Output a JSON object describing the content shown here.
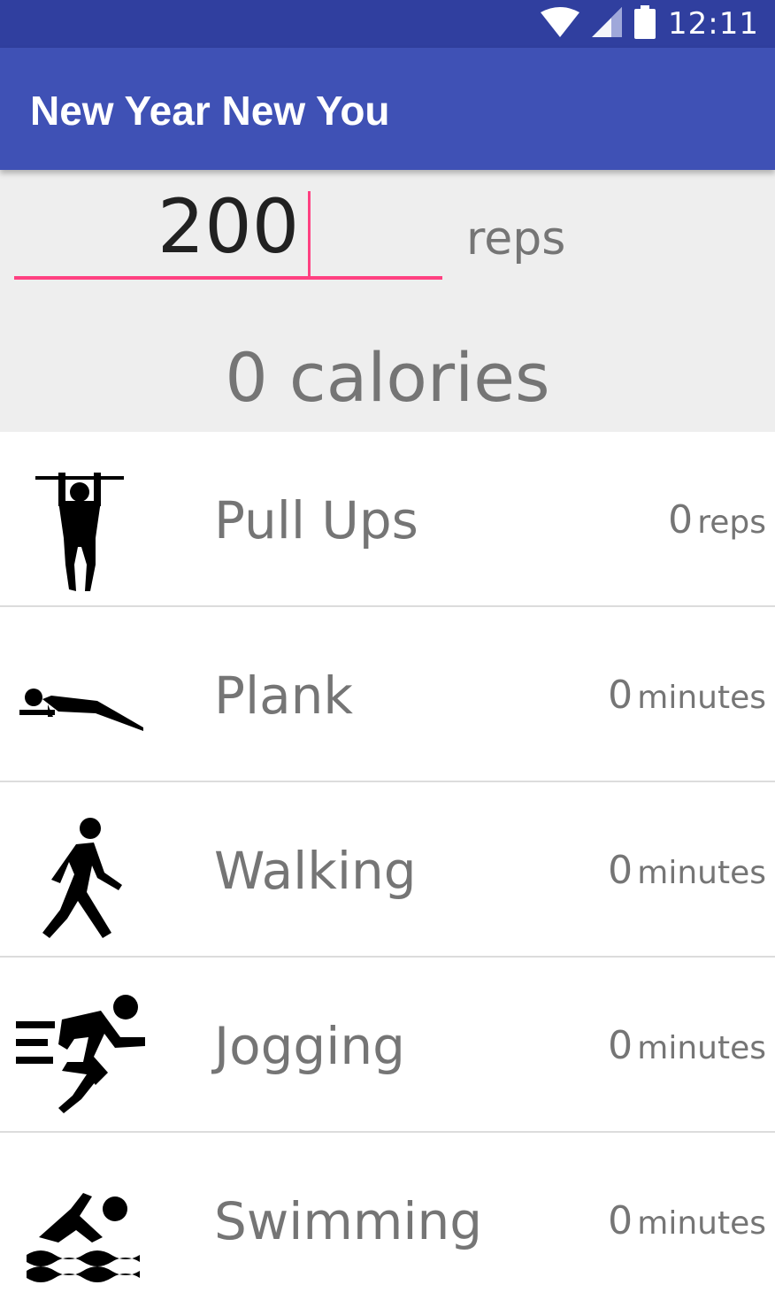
{
  "status_bar": {
    "time": "12:11",
    "icons": [
      "wifi-icon",
      "cell-signal-icon",
      "battery-icon"
    ],
    "color": "#303F9F"
  },
  "app_bar": {
    "title": "New Year New You",
    "color": "#3F51B5"
  },
  "summary": {
    "reps_value": "200",
    "unit_label": "reps",
    "calories_text": "0 calories",
    "accent_color": "#FF4081"
  },
  "exercises": [
    {
      "name": "Pull Ups",
      "amount": "0",
      "unit": "reps",
      "icon": "pull-up-icon"
    },
    {
      "name": "Plank",
      "amount": "0",
      "unit": "minutes",
      "icon": "plank-icon"
    },
    {
      "name": "Walking",
      "amount": "0",
      "unit": "minutes",
      "icon": "walking-icon"
    },
    {
      "name": "Jogging",
      "amount": "0",
      "unit": "minutes",
      "icon": "jogging-icon"
    },
    {
      "name": "Swimming",
      "amount": "0",
      "unit": "minutes",
      "icon": "swimming-icon"
    }
  ]
}
